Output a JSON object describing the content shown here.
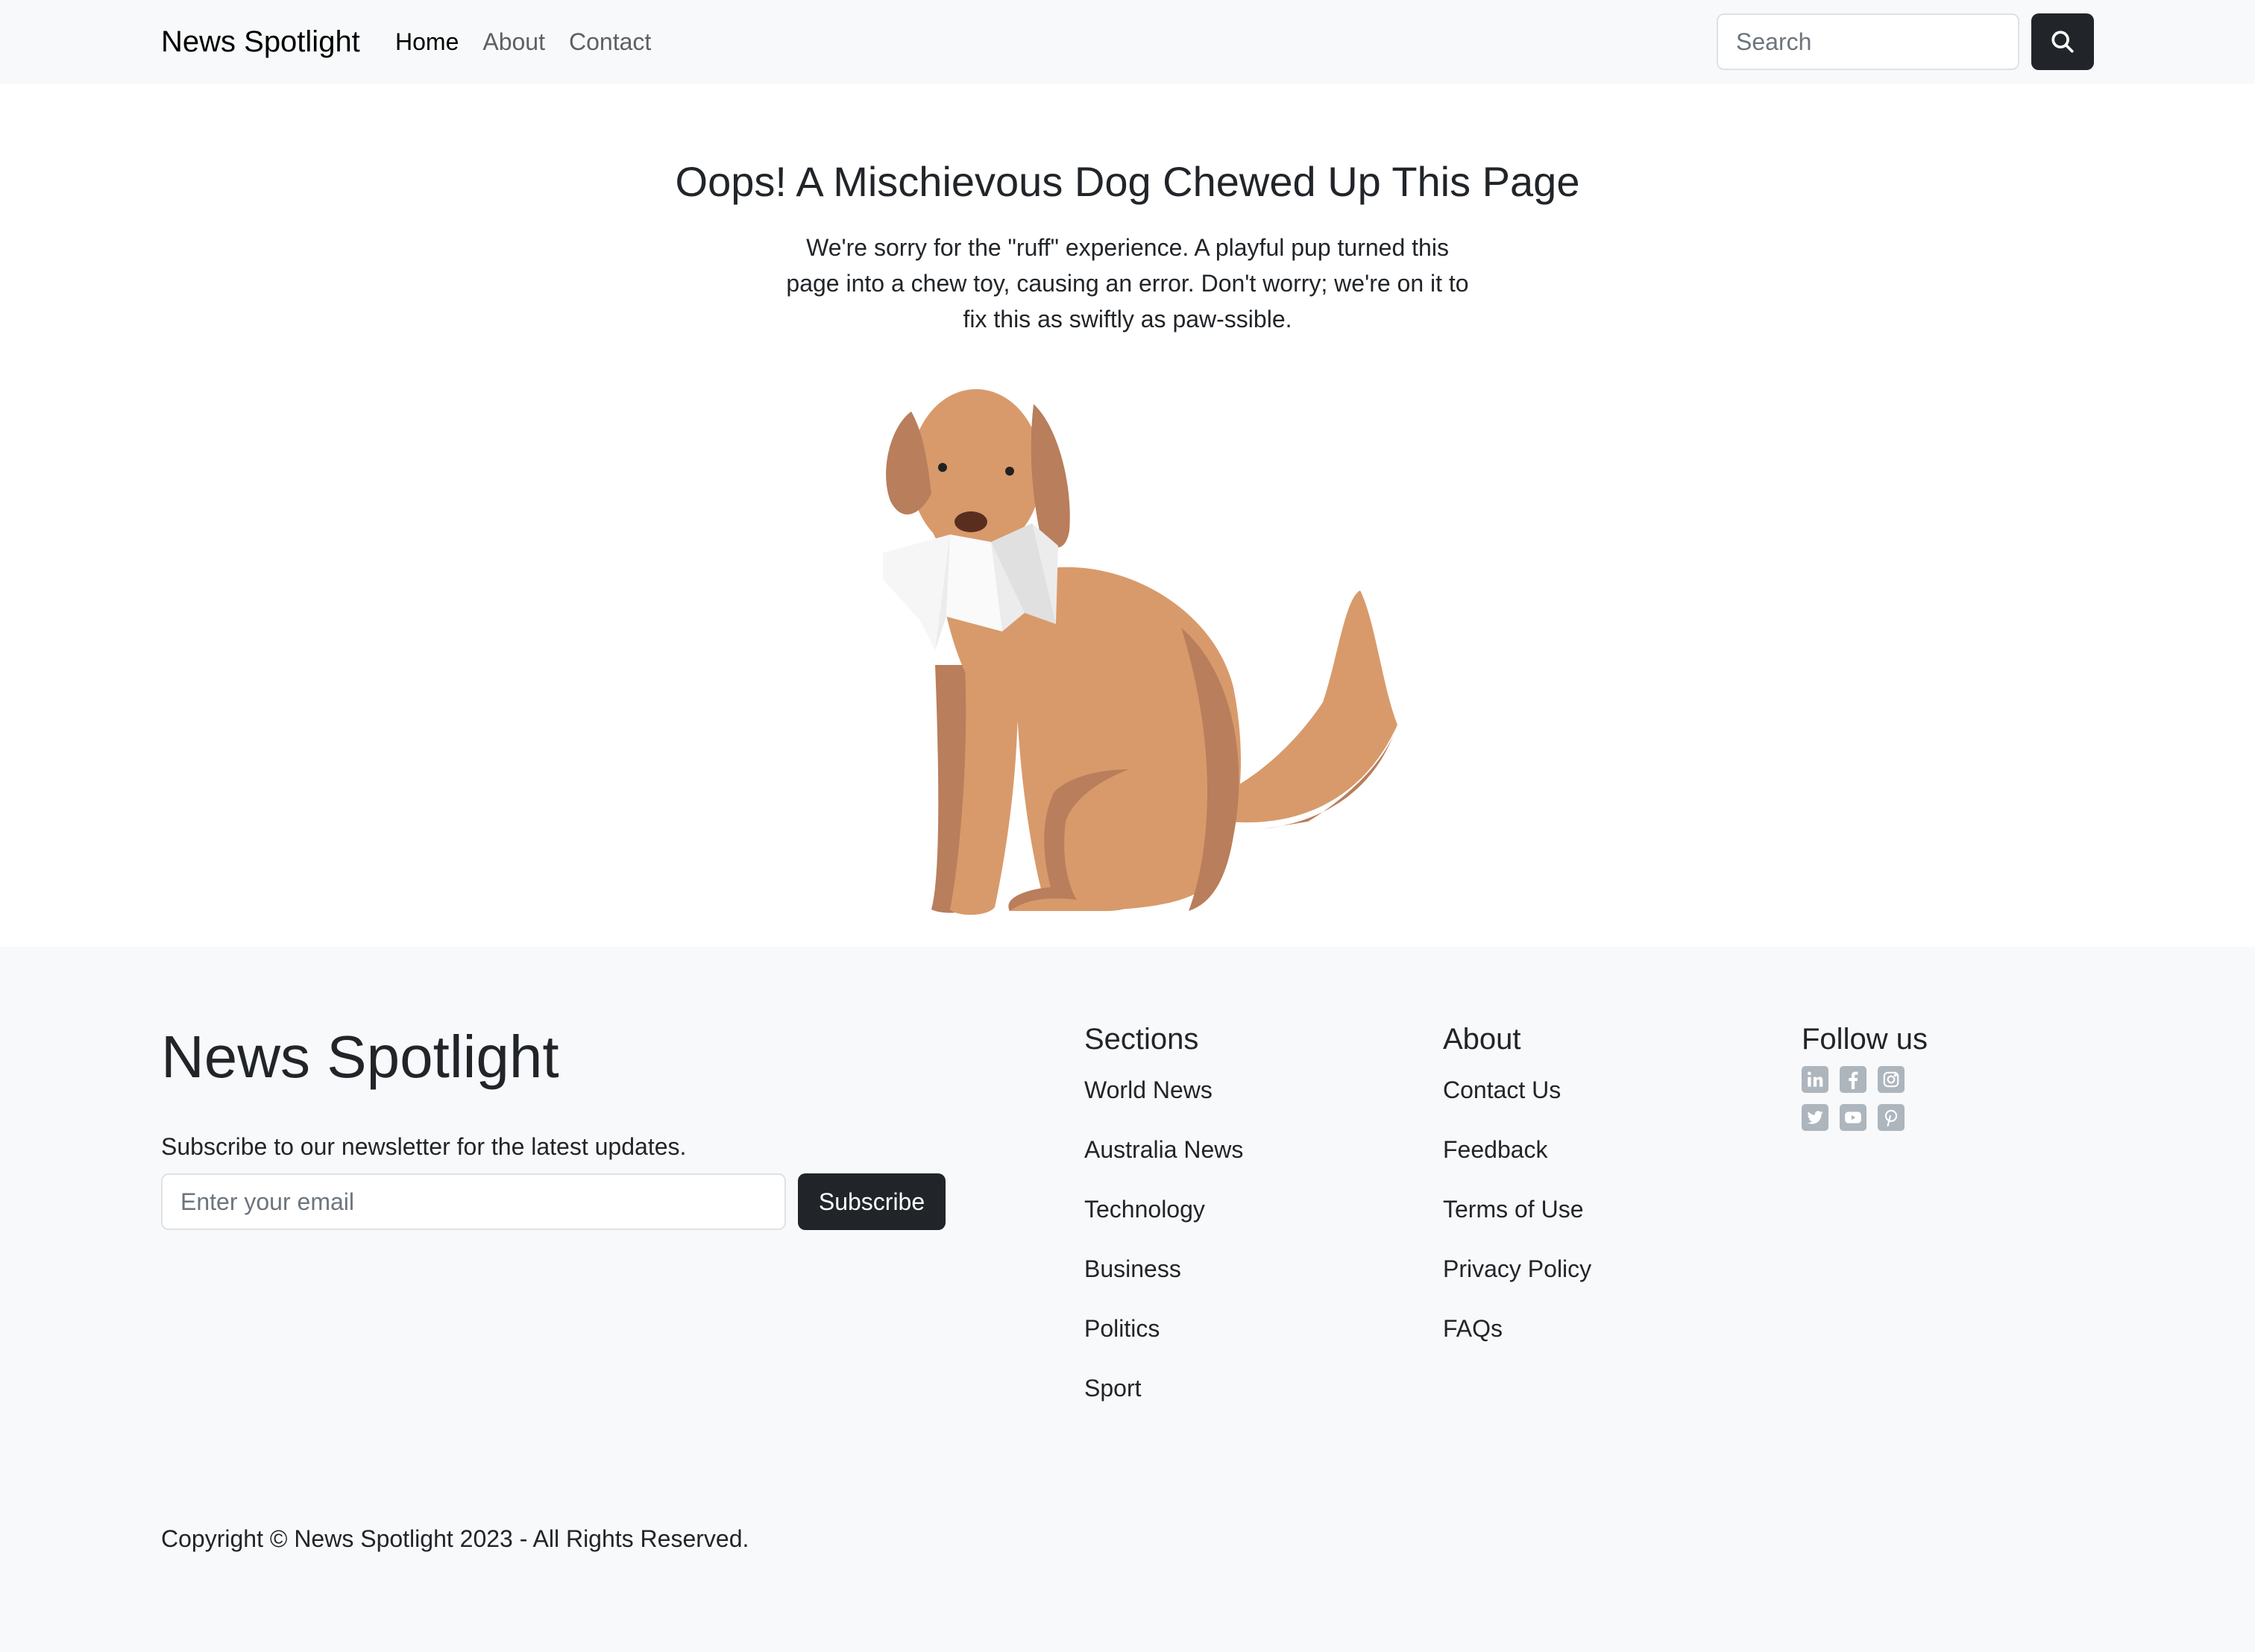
{
  "navbar": {
    "brand": "News Spotlight",
    "links": [
      {
        "label": "Home",
        "active": true
      },
      {
        "label": "About",
        "active": false
      },
      {
        "label": "Contact",
        "active": false
      }
    ],
    "search_placeholder": "Search",
    "search_icon": "search-icon"
  },
  "main": {
    "title": "Oops! A Mischievous Dog Chewed Up This Page",
    "message": "We're sorry for the \"ruff\" experience. A playful pup turned this page into a chew toy, causing an error. Don't worry; we're on it to fix this as swiftly as paw-ssible.",
    "illustration": "dog-chewing-paper"
  },
  "footer": {
    "brand": "News Spotlight",
    "newsletter_text": "Subscribe to our newsletter for the latest updates.",
    "email_placeholder": "Enter your email",
    "subscribe_label": "Subscribe",
    "sections": {
      "heading": "Sections",
      "items": [
        "World News",
        "Australia News",
        "Technology",
        "Business",
        "Politics",
        "Sport"
      ]
    },
    "about": {
      "heading": "About",
      "items": [
        "Contact Us",
        "Feedback",
        "Terms of Use",
        "Privacy Policy",
        "FAQs"
      ]
    },
    "follow": {
      "heading": "Follow us",
      "icons": [
        "linkedin-icon",
        "facebook-icon",
        "instagram-icon",
        "twitter-icon",
        "youtube-icon",
        "pinterest-icon"
      ]
    },
    "copyright": "Copyright © News Spotlight 2023 - All Rights Reserved."
  },
  "colors": {
    "navbar_bg": "#f8f9fa",
    "button_dark": "#212529",
    "social_icon": "#adb5bd",
    "dog_fur": "#d89a6b",
    "dog_shadow": "#b97e5b"
  }
}
